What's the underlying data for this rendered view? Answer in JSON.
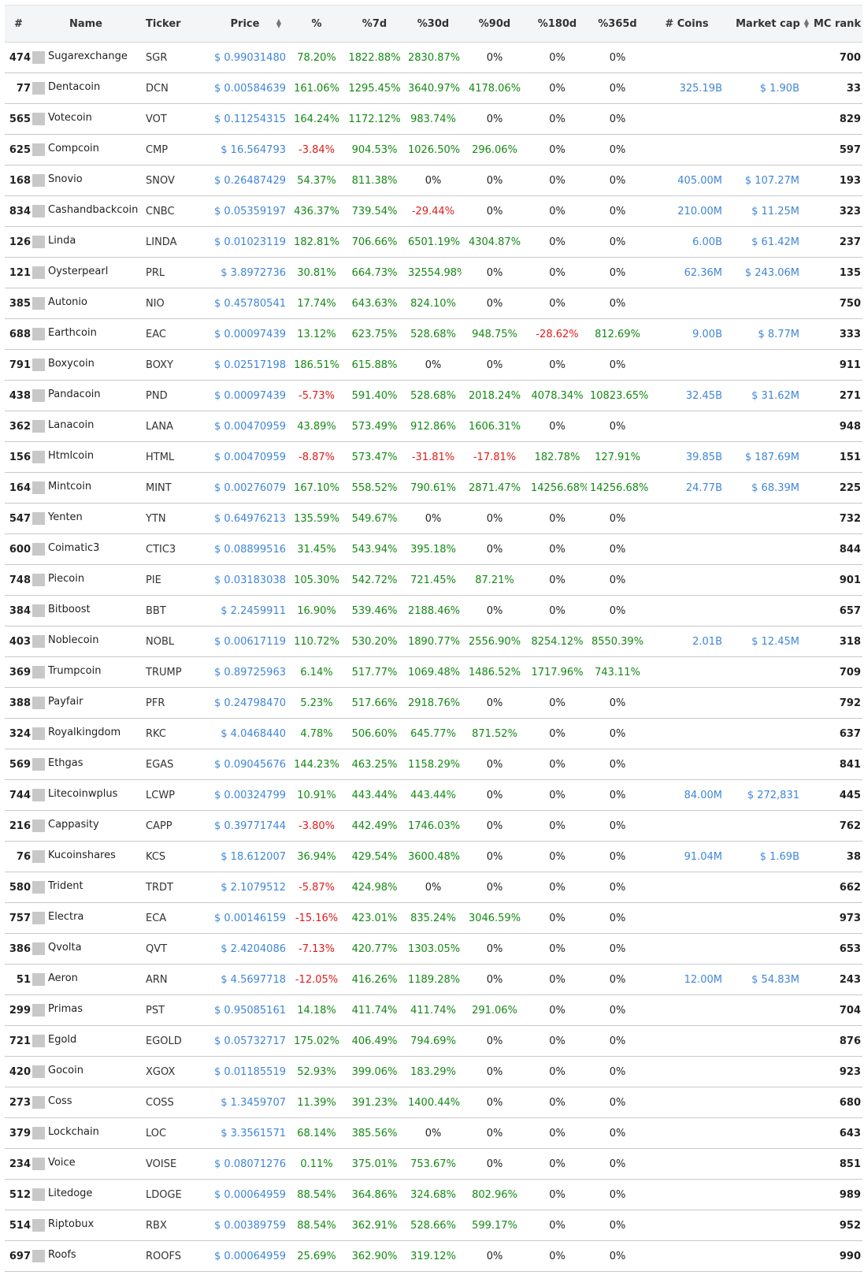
{
  "headers": {
    "rank": "#",
    "name": "Name",
    "ticker": "Ticker",
    "price": "Price",
    "pct": "%",
    "pct7d": "%7d",
    "pct30d": "%30d",
    "pct90d": "%90d",
    "pct180d": "%180d",
    "pct365d": "%365d",
    "coins": "# Coins",
    "mcap": "Market cap",
    "mcrank": "MC rank"
  },
  "colors": {
    "positive": "#138a13",
    "negative": "#e01b1b",
    "link": "#3f86d8"
  },
  "rows": [
    [
      "474",
      "Sugarexchange",
      "SGR",
      "$ 0.99031480",
      "78.20%",
      "1822.88%",
      "2830.87%",
      "0%",
      "0%",
      "0%",
      "",
      "",
      "700"
    ],
    [
      "77",
      "Dentacoin",
      "DCN",
      "$ 0.00584639",
      "161.06%",
      "1295.45%",
      "3640.97%",
      "4178.06%",
      "0%",
      "0%",
      "325.19B",
      "$ 1.90B",
      "33"
    ],
    [
      "565",
      "Votecoin",
      "VOT",
      "$ 0.11254315",
      "164.24%",
      "1172.12%",
      "983.74%",
      "0%",
      "0%",
      "0%",
      "",
      "",
      "829"
    ],
    [
      "625",
      "Compcoin",
      "CMP",
      "$ 16.564793",
      "-3.84%",
      "904.53%",
      "1026.50%",
      "296.06%",
      "0%",
      "0%",
      "",
      "",
      "597"
    ],
    [
      "168",
      "Snovio",
      "SNOV",
      "$ 0.26487429",
      "54.37%",
      "811.38%",
      "0%",
      "0%",
      "0%",
      "0%",
      "405.00M",
      "$ 107.27M",
      "193"
    ],
    [
      "834",
      "Cashandbackcoin",
      "CNBC",
      "$ 0.05359197",
      "436.37%",
      "739.54%",
      "-29.44%",
      "0%",
      "0%",
      "0%",
      "210.00M",
      "$ 11.25M",
      "323"
    ],
    [
      "126",
      "Linda",
      "LINDA",
      "$ 0.01023119",
      "182.81%",
      "706.66%",
      "6501.19%",
      "4304.87%",
      "0%",
      "0%",
      "6.00B",
      "$ 61.42M",
      "237"
    ],
    [
      "121",
      "Oysterpearl",
      "PRL",
      "$ 3.8972736",
      "30.81%",
      "664.73%",
      "32554.98%",
      "0%",
      "0%",
      "0%",
      "62.36M",
      "$ 243.06M",
      "135"
    ],
    [
      "385",
      "Autonio",
      "NIO",
      "$ 0.45780541",
      "17.74%",
      "643.63%",
      "824.10%",
      "0%",
      "0%",
      "0%",
      "",
      "",
      "750"
    ],
    [
      "688",
      "Earthcoin",
      "EAC",
      "$ 0.00097439",
      "13.12%",
      "623.75%",
      "528.68%",
      "948.75%",
      "-28.62%",
      "812.69%",
      "9.00B",
      "$ 8.77M",
      "333"
    ],
    [
      "791",
      "Boxycoin",
      "BOXY",
      "$ 0.02517198",
      "186.51%",
      "615.88%",
      "0%",
      "0%",
      "0%",
      "0%",
      "",
      "",
      "911"
    ],
    [
      "438",
      "Pandacoin",
      "PND",
      "$ 0.00097439",
      "-5.73%",
      "591.40%",
      "528.68%",
      "2018.24%",
      "4078.34%",
      "10823.65%",
      "32.45B",
      "$ 31.62M",
      "271"
    ],
    [
      "362",
      "Lanacoin",
      "LANA",
      "$ 0.00470959",
      "43.89%",
      "573.49%",
      "912.86%",
      "1606.31%",
      "0%",
      "0%",
      "",
      "",
      "948"
    ],
    [
      "156",
      "Htmlcoin",
      "HTML",
      "$ 0.00470959",
      "-8.87%",
      "573.47%",
      "-31.81%",
      "-17.81%",
      "182.78%",
      "127.91%",
      "39.85B",
      "$ 187.69M",
      "151"
    ],
    [
      "164",
      "Mintcoin",
      "MINT",
      "$ 0.00276079",
      "167.10%",
      "558.52%",
      "790.61%",
      "2871.47%",
      "14256.68%",
      "14256.68%",
      "24.77B",
      "$ 68.39M",
      "225"
    ],
    [
      "547",
      "Yenten",
      "YTN",
      "$ 0.64976213",
      "135.59%",
      "549.67%",
      "0%",
      "0%",
      "0%",
      "0%",
      "",
      "",
      "732"
    ],
    [
      "600",
      "Coimatic3",
      "CTIC3",
      "$ 0.08899516",
      "31.45%",
      "543.94%",
      "395.18%",
      "0%",
      "0%",
      "0%",
      "",
      "",
      "844"
    ],
    [
      "748",
      "Piecoin",
      "PIE",
      "$ 0.03183038",
      "105.30%",
      "542.72%",
      "721.45%",
      "87.21%",
      "0%",
      "0%",
      "",
      "",
      "901"
    ],
    [
      "384",
      "Bitboost",
      "BBT",
      "$ 2.2459911",
      "16.90%",
      "539.46%",
      "2188.46%",
      "0%",
      "0%",
      "0%",
      "",
      "",
      "657"
    ],
    [
      "403",
      "Noblecoin",
      "NOBL",
      "$ 0.00617119",
      "110.72%",
      "530.20%",
      "1890.77%",
      "2556.90%",
      "8254.12%",
      "8550.39%",
      "2.01B",
      "$ 12.45M",
      "318"
    ],
    [
      "369",
      "Trumpcoin",
      "TRUMP",
      "$ 0.89725963",
      "6.14%",
      "517.77%",
      "1069.48%",
      "1486.52%",
      "1717.96%",
      "743.11%",
      "",
      "",
      "709"
    ],
    [
      "388",
      "Payfair",
      "PFR",
      "$ 0.24798470",
      "5.23%",
      "517.66%",
      "2918.76%",
      "0%",
      "0%",
      "0%",
      "",
      "",
      "792"
    ],
    [
      "324",
      "Royalkingdom",
      "RKC",
      "$ 4.0468440",
      "4.78%",
      "506.60%",
      "645.77%",
      "871.52%",
      "0%",
      "0%",
      "",
      "",
      "637"
    ],
    [
      "569",
      "Ethgas",
      "EGAS",
      "$ 0.09045676",
      "144.23%",
      "463.25%",
      "1158.29%",
      "0%",
      "0%",
      "0%",
      "",
      "",
      "841"
    ],
    [
      "744",
      "Litecoinwplus",
      "LCWP",
      "$ 0.00324799",
      "10.91%",
      "443.44%",
      "443.44%",
      "0%",
      "0%",
      "0%",
      "84.00M",
      "$ 272,831",
      "445"
    ],
    [
      "216",
      "Cappasity",
      "CAPP",
      "$ 0.39771744",
      "-3.80%",
      "442.49%",
      "1746.03%",
      "0%",
      "0%",
      "0%",
      "",
      "",
      "762"
    ],
    [
      "76",
      "Kucoinshares",
      "KCS",
      "$ 18.612007",
      "36.94%",
      "429.54%",
      "3600.48%",
      "0%",
      "0%",
      "0%",
      "91.04M",
      "$ 1.69B",
      "38"
    ],
    [
      "580",
      "Trident",
      "TRDT",
      "$ 2.1079512",
      "-5.87%",
      "424.98%",
      "0%",
      "0%",
      "0%",
      "0%",
      "",
      "",
      "662"
    ],
    [
      "757",
      "Electra",
      "ECA",
      "$ 0.00146159",
      "-15.16%",
      "423.01%",
      "835.24%",
      "3046.59%",
      "0%",
      "0%",
      "",
      "",
      "973"
    ],
    [
      "386",
      "Qvolta",
      "QVT",
      "$ 2.4204086",
      "-7.13%",
      "420.77%",
      "1303.05%",
      "0%",
      "0%",
      "0%",
      "",
      "",
      "653"
    ],
    [
      "51",
      "Aeron",
      "ARN",
      "$ 4.5697718",
      "-12.05%",
      "416.26%",
      "1189.28%",
      "0%",
      "0%",
      "0%",
      "12.00M",
      "$ 54.83M",
      "243"
    ],
    [
      "299",
      "Primas",
      "PST",
      "$ 0.95085161",
      "14.18%",
      "411.74%",
      "411.74%",
      "291.06%",
      "0%",
      "0%",
      "",
      "",
      "704"
    ],
    [
      "721",
      "Egold",
      "EGOLD",
      "$ 0.05732717",
      "175.02%",
      "406.49%",
      "794.69%",
      "0%",
      "0%",
      "0%",
      "",
      "",
      "876"
    ],
    [
      "420",
      "Gocoin",
      "XGOX",
      "$ 0.01185519",
      "52.93%",
      "399.06%",
      "183.29%",
      "0%",
      "0%",
      "0%",
      "",
      "",
      "923"
    ],
    [
      "273",
      "Coss",
      "COSS",
      "$ 1.3459707",
      "11.39%",
      "391.23%",
      "1400.44%",
      "0%",
      "0%",
      "0%",
      "",
      "",
      "680"
    ],
    [
      "379",
      "Lockchain",
      "LOC",
      "$ 3.3561571",
      "68.14%",
      "385.56%",
      "0%",
      "0%",
      "0%",
      "0%",
      "",
      "",
      "643"
    ],
    [
      "234",
      "Voice",
      "VOISE",
      "$ 0.08071276",
      "0.11%",
      "375.01%",
      "753.67%",
      "0%",
      "0%",
      "0%",
      "",
      "",
      "851"
    ],
    [
      "512",
      "Litedoge",
      "LDOGE",
      "$ 0.00064959",
      "88.54%",
      "364.86%",
      "324.68%",
      "802.96%",
      "0%",
      "0%",
      "",
      "",
      "989"
    ],
    [
      "514",
      "Riptobux",
      "RBX",
      "$ 0.00389759",
      "88.54%",
      "362.91%",
      "528.66%",
      "599.17%",
      "0%",
      "0%",
      "",
      "",
      "952"
    ],
    [
      "697",
      "Roofs",
      "ROOFS",
      "$ 0.00064959",
      "25.69%",
      "362.90%",
      "319.12%",
      "0%",
      "0%",
      "0%",
      "",
      "",
      "990"
    ]
  ]
}
